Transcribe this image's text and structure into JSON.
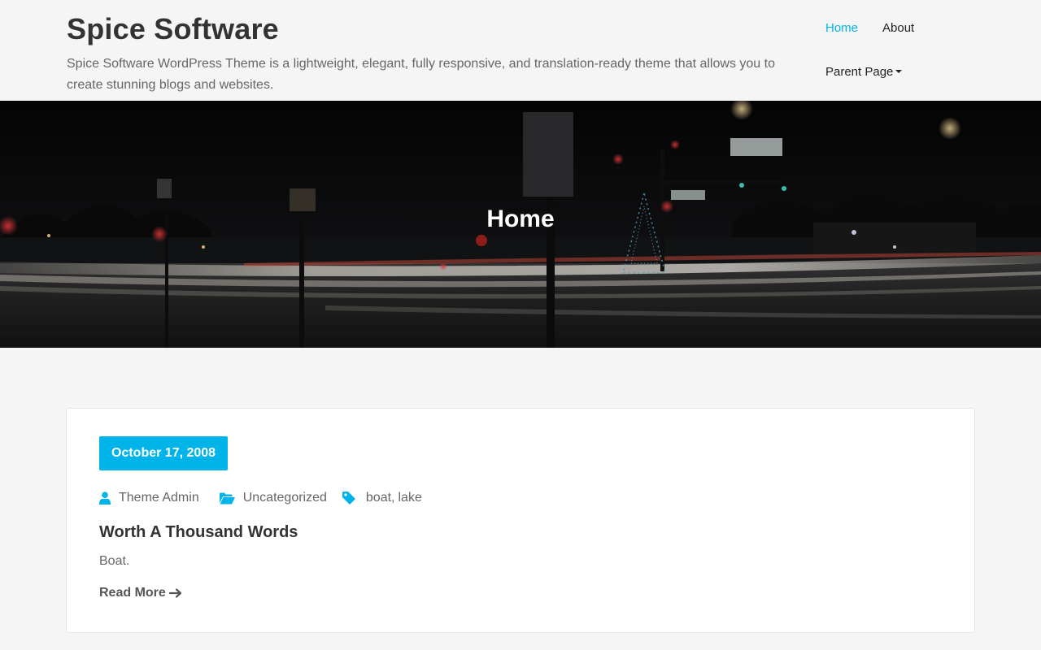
{
  "site": {
    "title": "Spice Software",
    "description": "Spice Software WordPress Theme is a lightweight, elegant, fully responsive, and translation-ready theme that allows you to create stunning blogs and websites."
  },
  "nav": {
    "items": [
      {
        "label": "Home",
        "active": true
      },
      {
        "label": "About",
        "active": false
      },
      {
        "label": "Parent Page",
        "active": false,
        "has_dropdown": true
      }
    ]
  },
  "hero": {
    "title": "Home"
  },
  "post": {
    "date": "October 17, 2008",
    "author": "Theme Admin",
    "category": "Uncategorized",
    "tags": [
      "boat",
      "lake"
    ],
    "tag_separator": ",",
    "title": "Worth A Thousand Words",
    "excerpt": "Boat.",
    "read_more_label": "Read More"
  },
  "colors": {
    "accent": "#00b4e9",
    "text_dark": "#333333",
    "text_muted": "#666666",
    "page_bg": "#f5f5f5"
  },
  "icons": {
    "author": "user-icon",
    "category": "folder-open-icon",
    "tags": "tag-icon",
    "read_more": "arrow-right-icon",
    "dropdown": "caret-down-icon"
  }
}
